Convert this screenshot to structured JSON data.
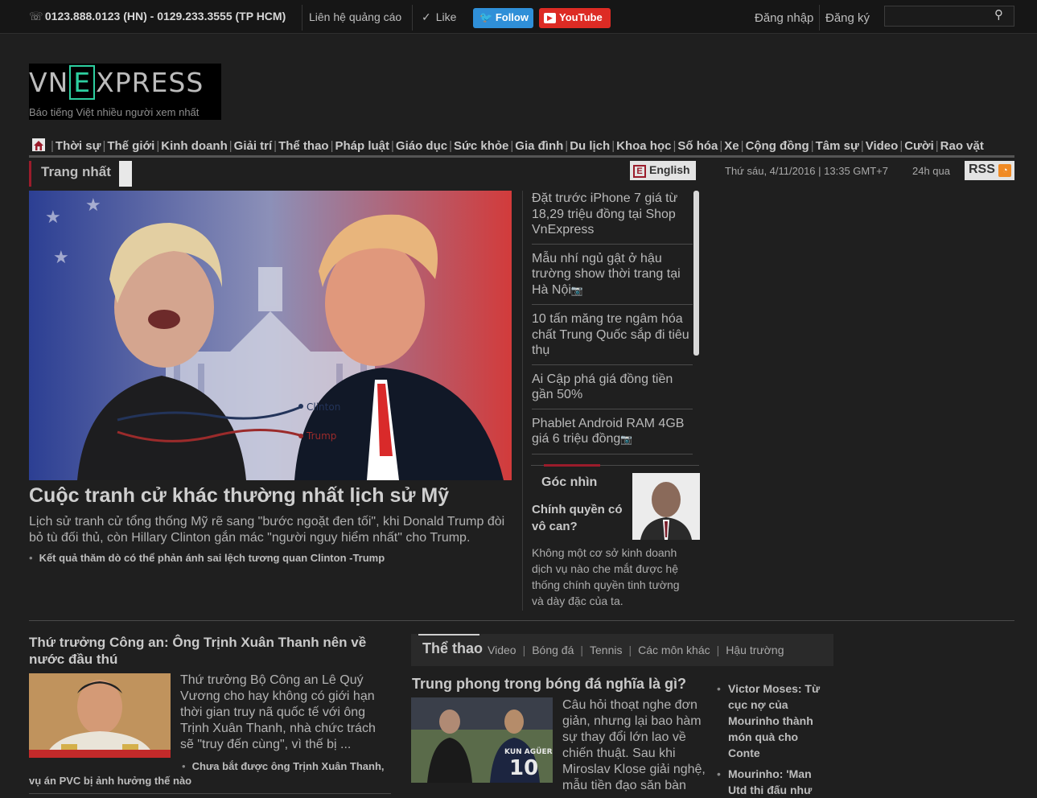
{
  "topbar": {
    "phone": "0123.888.0123 (HN) - 0129.233.3555 (TP HCM)",
    "ads": "Liên hệ quảng cáo",
    "like": "Like",
    "follow": "Follow",
    "youtube": "YouTube",
    "login": "Đăng nhập",
    "register": "Đăng ký",
    "search_value": ""
  },
  "logo": {
    "left": "VN",
    "mid": "E",
    "right": "XPRESS",
    "slogan": "Báo tiếng Việt nhiều người xem nhất"
  },
  "nav": {
    "items": [
      "Thời sự",
      "Thế giới",
      "Kinh doanh",
      "Giải trí",
      "Thể thao",
      "Pháp luật",
      "Giáo dục",
      "Sức khỏe",
      "Gia đình",
      "Du lịch",
      "Khoa học",
      "Số hóa",
      "Xe",
      "Cộng đồng",
      "Tâm sự",
      "Video",
      "Cười",
      "Rao vặt"
    ]
  },
  "subheader": {
    "section": "Trang nhất",
    "english": "English",
    "date": "Thứ sáu, 4/11/2016 | 13:35 GMT+7",
    "h24": "24h qua",
    "rss": "RSS"
  },
  "hero": {
    "chart_label_clinton": "Clinton",
    "chart_label_trump": "Trump",
    "title": "Cuộc tranh cử khác thường nhất lịch sử Mỹ",
    "desc": "Lịch sử tranh cử tổng thống Mỹ rẽ sang \"bước ngoặt đen tối\", khi Donald Trump đòi bỏ tù đối thủ, còn Hillary Clinton gắn mác \"người nguy hiểm nhất\" cho Trump.",
    "related": "Kết quả thăm dò có thể phản ánh sai lệch tương quan Clinton -Trump"
  },
  "mid_list": {
    "items": [
      {
        "text": "Đặt trước iPhone 7 giá từ 18,29 triệu đồng tại Shop VnExpress",
        "photo": false
      },
      {
        "text": "Mẫu nhí ngủ gật ở hậu trường show thời trang tại Hà Nội",
        "photo": true
      },
      {
        "text": "10 tấn măng tre ngâm hóa chất Trung Quốc sắp đi tiêu thụ",
        "photo": false
      },
      {
        "text": "Ai Cập phá giá đồng tiền gần 50%",
        "photo": false
      },
      {
        "text": "Phablet Android RAM 4GB giá 6 triệu đồng",
        "photo": true
      }
    ]
  },
  "goc_nhin": {
    "label": "Góc nhìn",
    "title": "Chính quyền có vô can?",
    "desc": "Không một cơ sở kinh doanh dịch vụ nào che mắt được hệ thống chính quyền tinh tường và dày đặc của ta."
  },
  "story2": {
    "title": "Thứ trưởng Công an: Ông Trịnh Xuân Thanh nên về nước đầu thú",
    "desc": "Thứ trưởng Bộ Công an Lê Quý Vương cho hay không có giới hạn thời gian truy nã quốc tế với ông Trịnh Xuân Thanh, nhà chức trách sẽ \"truy đến cùng\", vì thế bị ...",
    "related": "Chưa bắt được ông Trịnh Xuân Thanh, vụ án PVC bị ảnh hưởng thế nào"
  },
  "sport": {
    "title": "Thể thao",
    "subnav": [
      "Video",
      "Bóng đá",
      "Tennis",
      "Các môn khác",
      "Hậu trường"
    ],
    "story_title": "Trung phong trong bóng đá nghĩa là gì?",
    "desc": "Câu hỏi thoạt nghe đơn giản, nhưng lại bao hàm sự thay đổi lớn lao về chiến thuật. Sau khi Miroslav Klose giải nghệ, mẫu tiền đạo săn bàn",
    "jersey_name": "KUN AGÜERO",
    "jersey_number": "10",
    "side": [
      "Victor Moses: Từ cục nợ của Mourinho thành món quà cho Conte",
      "Mourinho: 'Man Utd thi đấu như"
    ]
  },
  "colors": {
    "background": "#1f1f1f",
    "accent_red": "#9b1c2b",
    "twitter_blue": "#2f8fd8",
    "youtube_red": "#dd2b24",
    "logo_green": "#2dcfa0"
  },
  "icons": [
    "phone-icon",
    "check-icon",
    "twitter-bird-icon",
    "youtube-play-icon",
    "search-icon",
    "home-icon",
    "english-e-icon",
    "rss-feed-icon",
    "camera-icon"
  ]
}
